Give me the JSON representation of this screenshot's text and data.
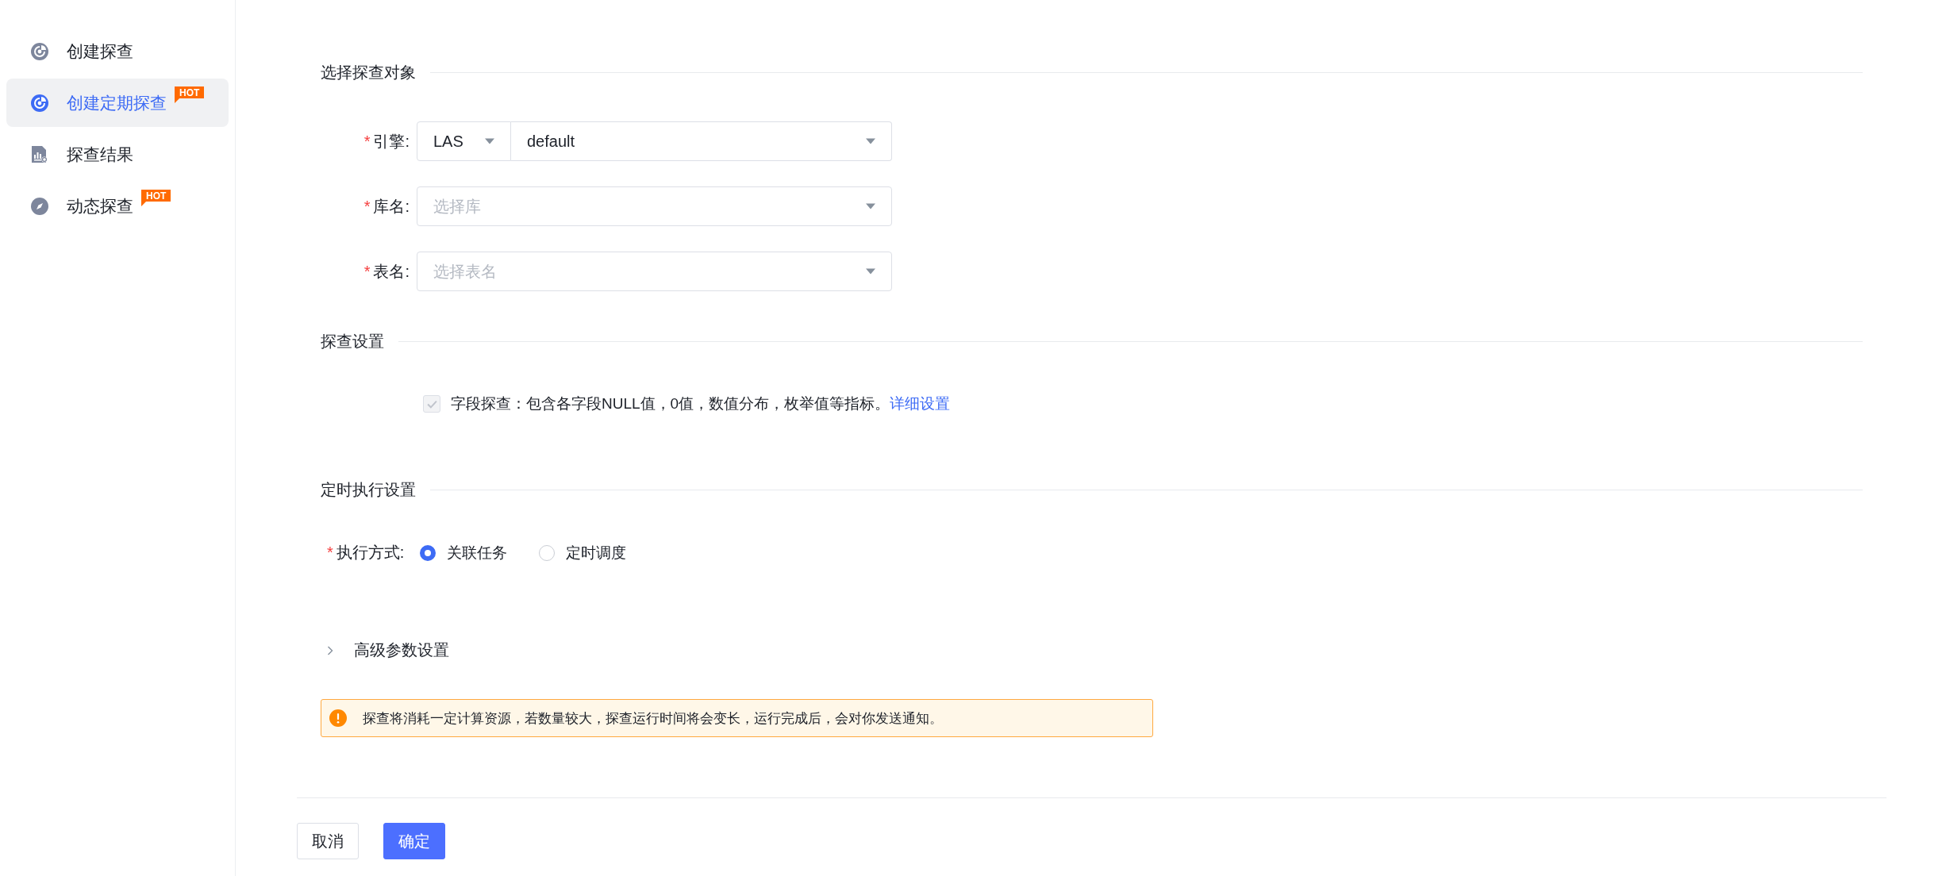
{
  "sidebar": {
    "items": [
      {
        "label": "创建探查",
        "kind": "radar",
        "selected": false
      },
      {
        "label": "创建定期探查",
        "kind": "radar",
        "selected": true,
        "badge": "HOT"
      },
      {
        "label": "探查结果",
        "kind": "report",
        "selected": false
      },
      {
        "label": "动态探查",
        "kind": "compass",
        "selected": false,
        "badge": "HOT"
      }
    ]
  },
  "object_section": {
    "title": "选择探查对象",
    "fields": [
      {
        "mark": "*",
        "label": "引擎:",
        "selects": [
          {
            "value": "LAS"
          },
          {
            "value": "default"
          }
        ]
      },
      {
        "mark": "*",
        "label": "库名:",
        "selects": [
          {
            "placeholder": "选择库"
          }
        ]
      },
      {
        "mark": "*",
        "label": "表名:",
        "selects": [
          {
            "placeholder": "选择表名"
          }
        ]
      }
    ]
  },
  "probe_settings": {
    "title": "探查设置",
    "checkbox": {
      "label": "字段探查：包含各字段NULL值，0值，数值分布，枚举值等指标。",
      "checked": true,
      "disabled": true,
      "link": "详细设置"
    }
  },
  "schedule": {
    "title": "定时执行设置",
    "field": {
      "mark": "*",
      "label": "执行方式:",
      "options": [
        {
          "label": "关联任务",
          "selected": true
        },
        {
          "label": "定时调度",
          "selected": false
        }
      ]
    }
  },
  "advanced": {
    "label": "高级参数设置",
    "expanded": false
  },
  "alert": {
    "text": "探查将消耗一定计算资源，若数量较大，探查运行时间将会变长，运行完成后，会对你发送通知。"
  },
  "buttons": [
    {
      "label": "取消",
      "kind": "default"
    },
    {
      "label": "确定",
      "kind": "primary"
    }
  ]
}
